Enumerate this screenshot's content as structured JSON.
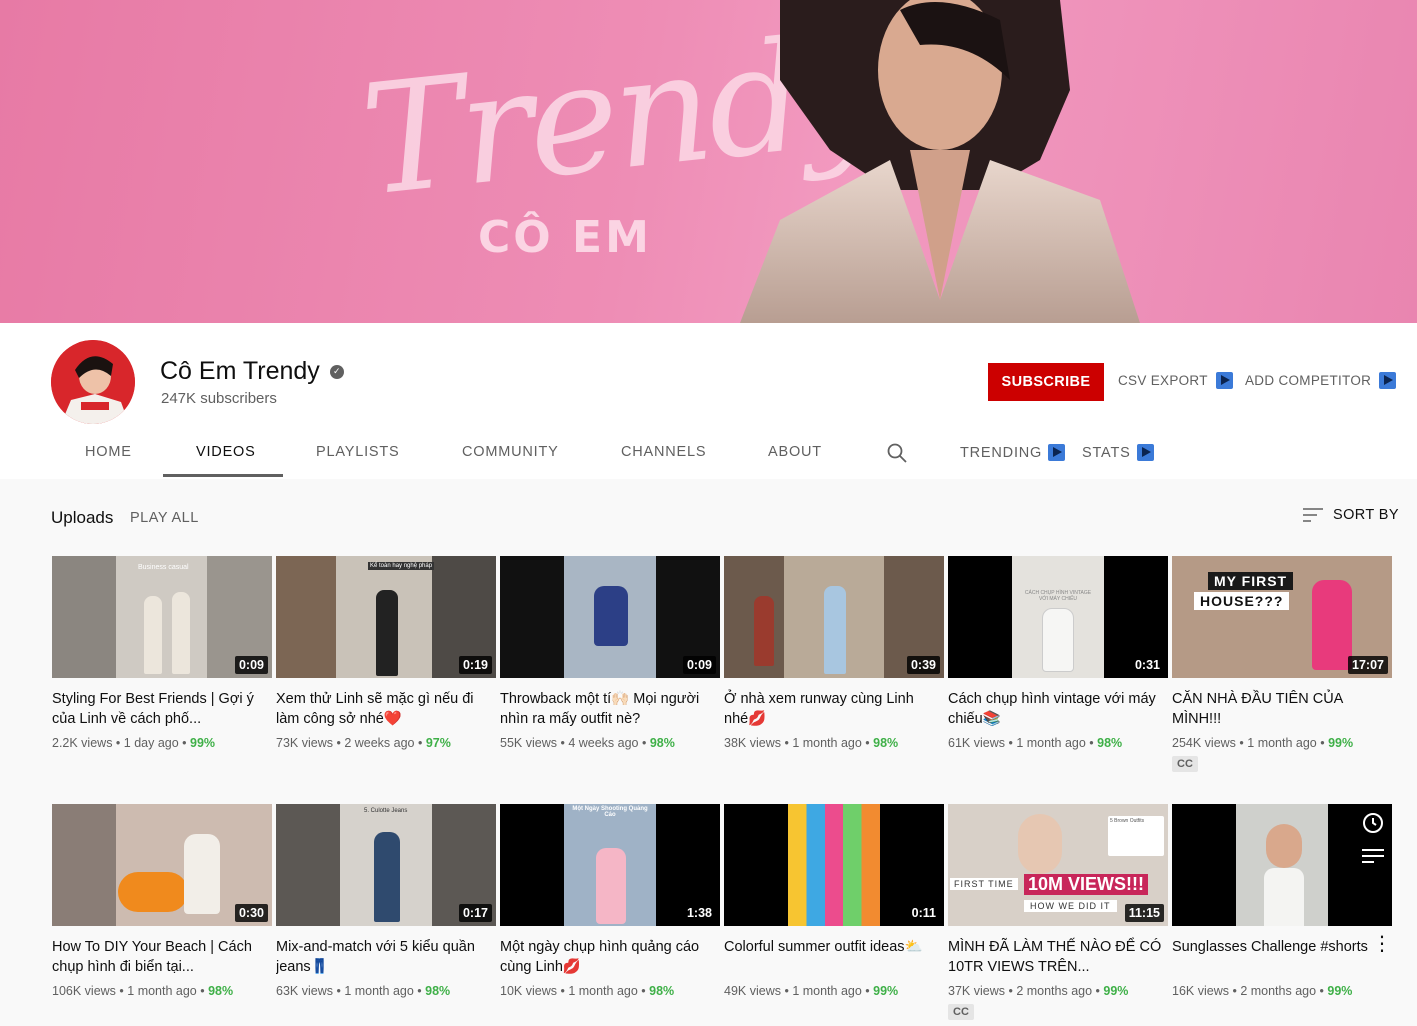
{
  "banner": {
    "script_text": "Trendy",
    "sub_text": "CÔ EM"
  },
  "channel": {
    "name": "Cô Em Trendy",
    "verified": true,
    "subscribers": "247K subscribers"
  },
  "actions": {
    "subscribe": "SUBSCRIBE",
    "csv_export": "CSV EXPORT",
    "add_competitor": "ADD COMPETITOR"
  },
  "tabs": [
    {
      "label": "HOME"
    },
    {
      "label": "VIDEOS",
      "active": true
    },
    {
      "label": "PLAYLISTS"
    },
    {
      "label": "COMMUNITY"
    },
    {
      "label": "CHANNELS"
    },
    {
      "label": "ABOUT"
    },
    {
      "label": "TRENDING"
    },
    {
      "label": "STATS"
    }
  ],
  "uploads": {
    "title": "Uploads",
    "play_all": "PLAY ALL",
    "sort_by": "SORT BY"
  },
  "videos": [
    {
      "title": "Styling For Best Friends | Gợi ý của Linh về cách phố...",
      "duration": "0:09",
      "views": "2.2K views",
      "age": "1 day ago",
      "pct": "99%",
      "bg": "#cfcac3",
      "cc": false
    },
    {
      "title": "Xem thử Linh sẽ mặc gì nếu đi làm công sở nhé❤️",
      "duration": "0:19",
      "views": "73K views",
      "age": "2 weeks ago",
      "pct": "97%",
      "bg": "#8a7462",
      "cc": false
    },
    {
      "title": "Throwback một tí🙌🏻 Mọi người nhìn ra mấy outfit nè?",
      "duration": "0:09",
      "views": "55K views",
      "age": "4 weeks ago",
      "pct": "98%",
      "bg": "#9aa9b8",
      "cc": false
    },
    {
      "title": "Ở nhà xem runway cùng Linh nhé💋",
      "duration": "0:39",
      "views": "38K views",
      "age": "1 month ago",
      "pct": "98%",
      "bg": "#7f6b5c",
      "cc": false
    },
    {
      "title": "Cách chụp hình vintage với máy chiếu📚",
      "duration": "0:31",
      "views": "61K views",
      "age": "1 month ago",
      "pct": "98%",
      "bg": "#111111",
      "cc": false
    },
    {
      "title": "CĂN NHÀ ĐẦU TIÊN CỦA MÌNH!!!",
      "duration": "17:07",
      "views": "254K views",
      "age": "1 month ago",
      "pct": "99%",
      "bg": "#b79a86",
      "cc": true
    },
    {
      "title": "How To DIY Your Beach | Cách chụp hình đi biển tại...",
      "duration": "0:30",
      "views": "106K views",
      "age": "1 month ago",
      "pct": "98%",
      "bg": "#c7b3a8",
      "cc": false
    },
    {
      "title": "Mix-and-match với 5 kiểu quần jeans👖",
      "duration": "0:17",
      "views": "63K views",
      "age": "1 month ago",
      "pct": "98%",
      "bg": "#6b6660",
      "cc": false
    },
    {
      "title": "Một ngày chụp hình quảng cáo cùng Linh💋",
      "duration": "1:38",
      "views": "10K views",
      "age": "1 month ago",
      "pct": "98%",
      "bg": "#111111",
      "cc": false
    },
    {
      "title": "Colorful summer outfit ideas⛅",
      "duration": "0:11",
      "views": "49K views",
      "age": "1 month ago",
      "pct": "99%",
      "bg": "#111111",
      "cc": false
    },
    {
      "title": "MÌNH ĐÃ LÀM THẾ NÀO ĐỂ CÓ 10TR VIEWS TRÊN...",
      "duration": "11:15",
      "views": "37K views",
      "age": "2 months ago",
      "pct": "99%",
      "bg": "#d9d2cc",
      "cc": true
    },
    {
      "title": "Sunglasses Challenge #shorts",
      "duration": "",
      "views": "16K views",
      "age": "2 months ago",
      "pct": "99%",
      "bg": "#111111",
      "cc": false
    }
  ],
  "thumb_texts": {
    "v1": "Business casual",
    "v2": "Kể toàn hay nghệ pháp",
    "v5": "CÁCH CHỤP HÌNH VINTAGE VỚI MÁY CHIẾU",
    "v6_a": "MY FIRST",
    "v6_b": "HOUSE???",
    "v8": "5. Culotte Jeans",
    "v9": "Một Ngày Shooting Quảng Cáo",
    "v11_a": "FIRST TIME",
    "v11_b": "10M VIEWS!!!",
    "v11_c": "HOW WE DID IT",
    "v11_d": "5 Brown Outfits"
  },
  "cc_label": "CC",
  "colors": {
    "subscribe": "#cc0000",
    "percent": "#3fb048",
    "ext_icon": "#3b7ad8",
    "banner": "#ee8db5"
  },
  "icons": {
    "search": "search-icon",
    "sort": "sort-icon",
    "verified": "verified-check-icon",
    "ext": "play-flag-icon",
    "more": "kebab-menu-icon",
    "watch_later": "clock-icon",
    "add_queue": "add-to-queue-icon"
  }
}
